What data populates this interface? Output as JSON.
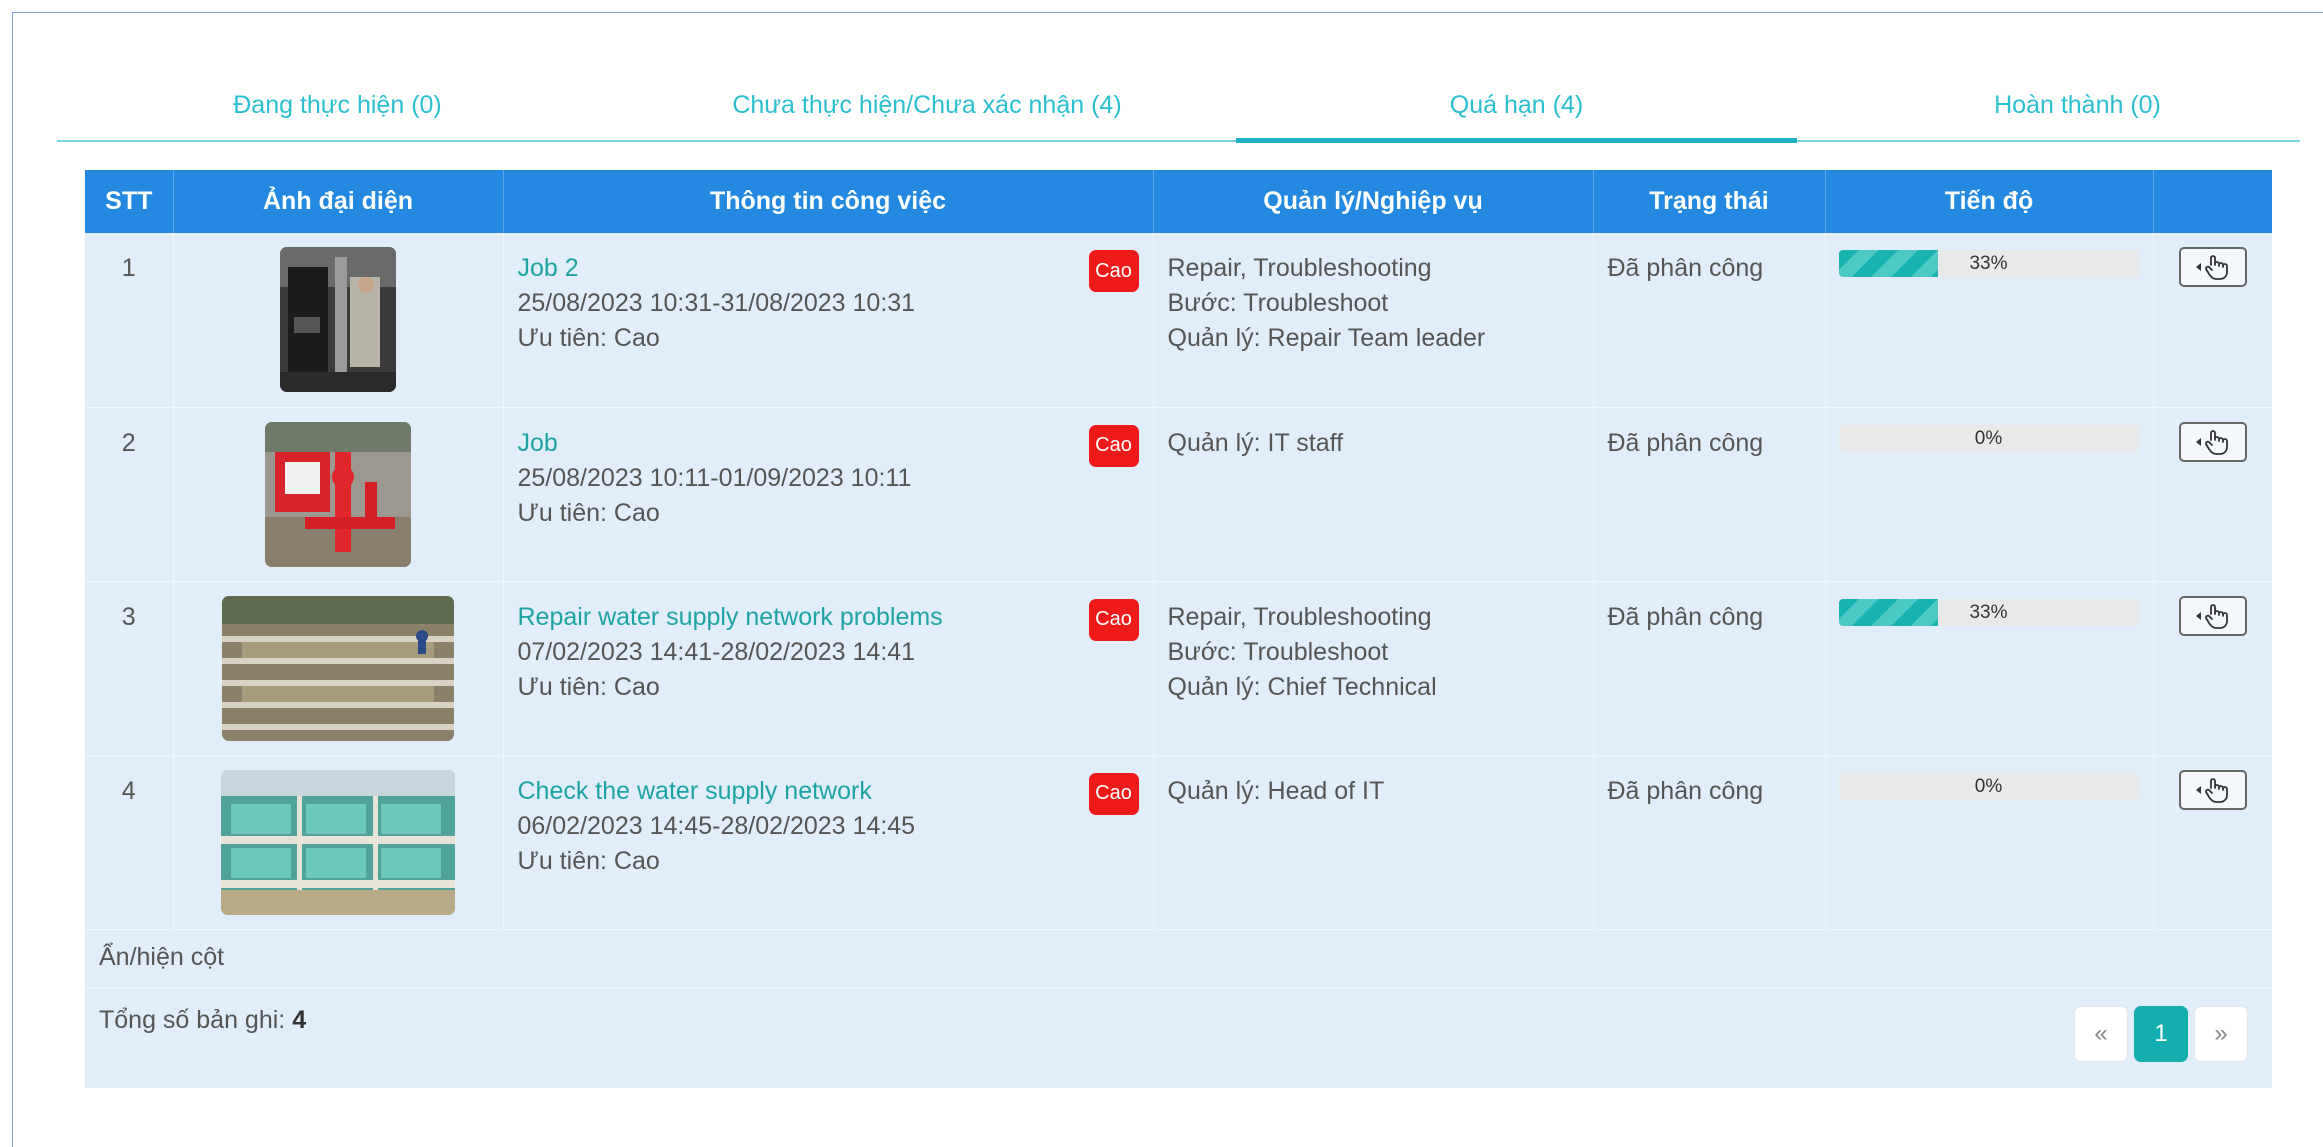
{
  "tabs": [
    {
      "label": "Đang thực hiện (0)"
    },
    {
      "label": "Chưa thực hiện/Chưa xác nhận (4)"
    },
    {
      "label": "Quá hạn (4)"
    },
    {
      "label": "Hoàn thành (0)"
    }
  ],
  "active_tab": "Quá hạn (4)",
  "table": {
    "headers": [
      "STT",
      "Ảnh đại diện",
      "Thông tin công việc",
      "Quản lý/Nghiệp vụ",
      "Trạng thái",
      "Tiến độ",
      ""
    ],
    "rows": [
      {
        "stt": "1",
        "title": "Job 2",
        "time": "25/08/2023 10:31-31/08/2023 10:31",
        "priority": "Ưu tiên: Cao",
        "badge": "Cao",
        "mgr1": "Repair, Troubleshooting",
        "mgr2": "Bước: Troubleshoot",
        "mgr3": "Quản lý: Repair Team leader",
        "status": "Đã phân công",
        "progress": 33,
        "progress_label": "33%"
      },
      {
        "stt": "2",
        "title": "Job",
        "time": "25/08/2023 10:11-01/09/2023 10:11",
        "priority": "Ưu tiên: Cao",
        "badge": "Cao",
        "mgr1": "Quản lý: IT staff",
        "mgr2": "",
        "mgr3": "",
        "status": "Đã phân công",
        "progress": 0,
        "progress_label": "0%"
      },
      {
        "stt": "3",
        "title": "Repair water supply network problems",
        "time": "07/02/2023 14:41-28/02/2023 14:41",
        "priority": "Ưu tiên: Cao",
        "badge": "Cao",
        "mgr1": "Repair, Troubleshooting",
        "mgr2": "Bước: Troubleshoot",
        "mgr3": "Quản lý: Chief Technical",
        "status": "Đã phân công",
        "progress": 33,
        "progress_label": "33%"
      },
      {
        "stt": "4",
        "title": "Check the water supply network",
        "time": "06/02/2023 14:45-28/02/2023 14:45",
        "priority": "Ưu tiên: Cao",
        "badge": "Cao",
        "mgr1": "Quản lý: Head of IT",
        "mgr2": "",
        "mgr3": "",
        "status": "Đã phân công",
        "progress": 0,
        "progress_label": "0%"
      }
    ]
  },
  "toggle_columns_label": "Ẩn/hiện cột",
  "total_label": "Tổng số bản ghi:",
  "total_value": "4",
  "pager": {
    "prev": "«",
    "current": "1",
    "next": "»"
  },
  "colors": {
    "header": "#2388e0",
    "accent": "#1fb2c4",
    "badge": "#ef1b1b",
    "panel": "#e1eefa"
  },
  "icons": {
    "row_action": "hand-pointer-icon"
  }
}
